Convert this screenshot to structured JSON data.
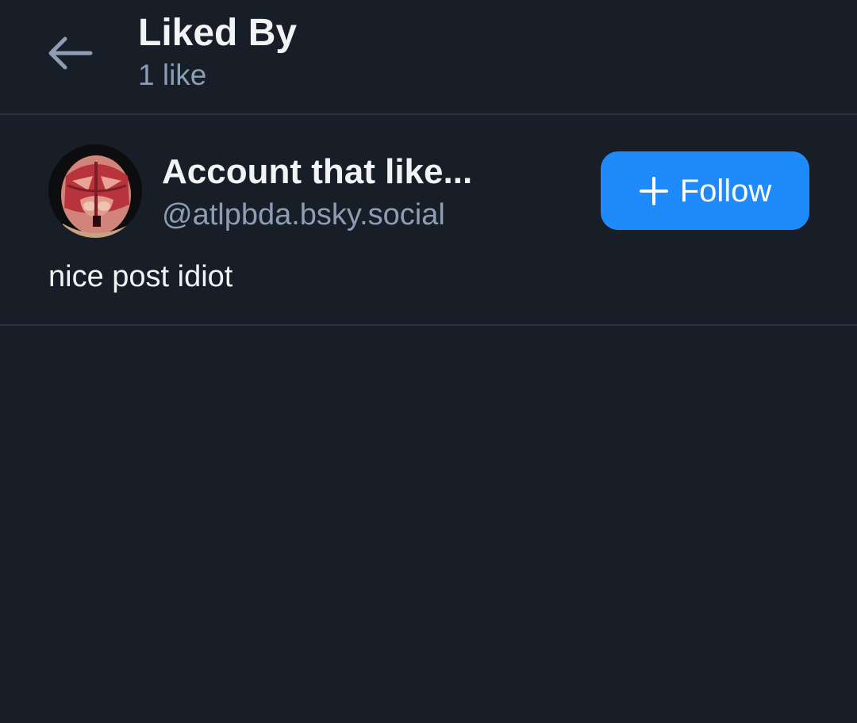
{
  "header": {
    "title": "Liked By",
    "subtitle": "1 like"
  },
  "likes": [
    {
      "display_name": "Account that like...",
      "handle": "@atlpbda.bsky.social",
      "follow_label": "Follow",
      "bio": "nice post idiot"
    }
  ],
  "icons": {
    "back": "arrow-left-icon",
    "follow": "plus-icon"
  },
  "colors": {
    "background": "#171e28",
    "divider": "#283240",
    "primary_text": "#f1f3f5",
    "secondary_text": "#8d9db3",
    "accent": "#1f8bfb"
  }
}
